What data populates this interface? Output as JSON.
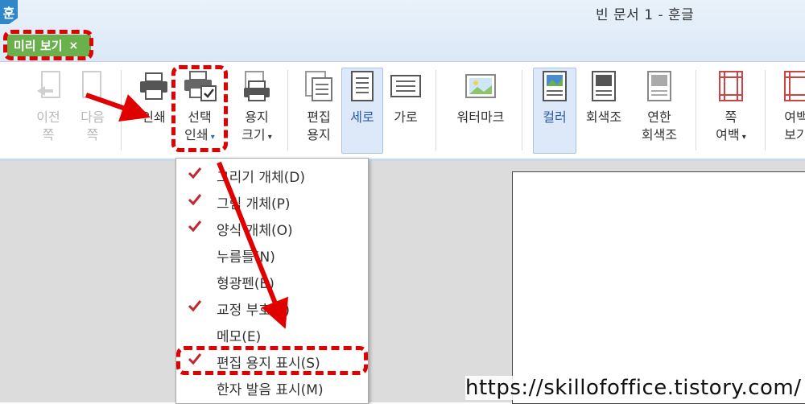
{
  "window": {
    "title": "빈 문서 1 - 훈글",
    "logo_text": "훈"
  },
  "tab": {
    "label": "미리 보기",
    "close": "×"
  },
  "ribbon": {
    "prev": {
      "line1": "이전",
      "line2": "쪽"
    },
    "next": {
      "line1": "다음",
      "line2": "쪽"
    },
    "print": {
      "label": "인쇄"
    },
    "select_print": {
      "line1": "선택",
      "line2": "인쇄"
    },
    "paper_size": {
      "line1": "용지",
      "line2": "크기"
    },
    "edit_paper": {
      "line1": "편집",
      "line2": "용지"
    },
    "portrait": {
      "label": "세로"
    },
    "landscape": {
      "label": "가로"
    },
    "watermark": {
      "label": "워터마크"
    },
    "color": {
      "label": "컬러"
    },
    "grayscale": {
      "label": "회색조"
    },
    "light_gray": {
      "line1": "연한",
      "line2": "회색조"
    },
    "page_margin": {
      "line1": "쪽",
      "line2": "여백"
    },
    "margin_view": {
      "line1": "여백",
      "line2": "보기"
    }
  },
  "menu": {
    "items": [
      {
        "label": "그리기 개체(D)",
        "checked": true
      },
      {
        "label": "그림 개체(P)",
        "checked": true
      },
      {
        "label": "양식 개체(O)",
        "checked": true
      },
      {
        "label": "누름틀(N)",
        "checked": false
      },
      {
        "label": "형광펜(B)",
        "checked": false
      },
      {
        "label": "교정 부호(F)",
        "checked": true
      },
      {
        "label": "메모(E)",
        "checked": false
      },
      {
        "label": "편집 용지 표시(S)",
        "checked": true
      },
      {
        "label": "한자 발음 표시(M)",
        "checked": false
      }
    ]
  },
  "watermark_url": "https://skillofoffice.tistory.com/",
  "colors": {
    "highlight": "#e00000",
    "tab_green": "#6ab04c",
    "check_red": "#c0282d"
  }
}
